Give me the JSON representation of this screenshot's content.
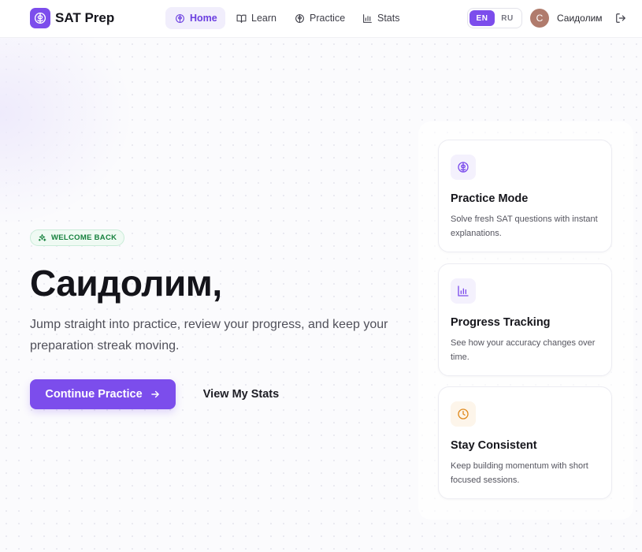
{
  "brand": {
    "name": "SAT Prep",
    "icon": "brain-icon"
  },
  "nav": {
    "items": [
      {
        "label": "Home",
        "icon": "brain-icon",
        "active": true
      },
      {
        "label": "Learn",
        "icon": "book-icon",
        "active": false
      },
      {
        "label": "Practice",
        "icon": "brain-icon",
        "active": false
      },
      {
        "label": "Stats",
        "icon": "bar-chart-icon",
        "active": false
      }
    ]
  },
  "language": {
    "options": [
      "EN",
      "RU"
    ],
    "selected": "EN"
  },
  "user": {
    "initial": "С",
    "name": "Саидолим",
    "logout_icon": "logout-icon"
  },
  "hero": {
    "badge": "WELCOME BACK",
    "title": "Саидолим,",
    "subtitle": "Jump straight into practice, review your progress, and keep your preparation streak moving.",
    "primary_button": "Continue Practice",
    "secondary_button": "View My Stats"
  },
  "features": [
    {
      "title": "Practice Mode",
      "description": "Solve fresh SAT questions with instant explanations.",
      "icon": "brain-icon"
    },
    {
      "title": "Progress Tracking",
      "description": "See how your accuracy changes over time.",
      "icon": "bar-chart-icon"
    },
    {
      "title": "Stay Consistent",
      "description": "Keep building momentum with short focused sessions.",
      "icon": "clock-icon"
    }
  ],
  "colors": {
    "accent": "#7c4dec",
    "accent_soft": "#f1eefc",
    "success": "#15803d",
    "success_soft": "#effaf3",
    "warning": "#e08a1e",
    "avatar": "#b07b6c"
  }
}
